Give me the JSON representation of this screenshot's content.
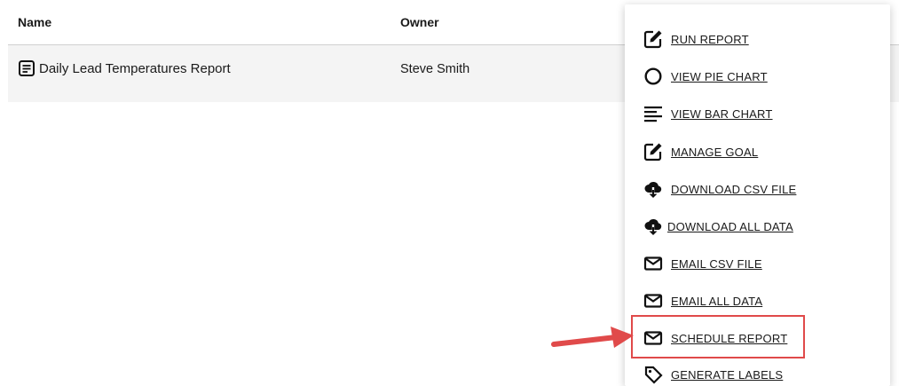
{
  "table": {
    "columns": [
      "Name",
      "Owner"
    ],
    "rows": [
      {
        "name": "Daily Lead Temperatures Report",
        "owner": "Steve Smith",
        "icon": "document-icon"
      }
    ]
  },
  "menu": {
    "items": [
      {
        "label": "RUN REPORT",
        "icon": "edit-icon"
      },
      {
        "label": "VIEW PIE CHART",
        "icon": "circle-icon"
      },
      {
        "label": "VIEW BAR CHART",
        "icon": "bars-icon"
      },
      {
        "label": "MANAGE GOAL",
        "icon": "edit-icon"
      },
      {
        "label": "DOWNLOAD CSV FILE",
        "icon": "cloud-download-icon"
      },
      {
        "label": "DOWNLOAD ALL DATA",
        "icon": "cloud-download-icon"
      },
      {
        "label": "EMAIL CSV FILE",
        "icon": "mail-icon"
      },
      {
        "label": "EMAIL ALL DATA",
        "icon": "mail-icon"
      },
      {
        "label": "SCHEDULE REPORT",
        "icon": "mail-icon"
      },
      {
        "label": "GENERATE LABELS",
        "icon": "tag-icon"
      }
    ]
  },
  "annotation": {
    "highlight_color": "#e04a4a",
    "highlighted_item": "SCHEDULE REPORT"
  }
}
